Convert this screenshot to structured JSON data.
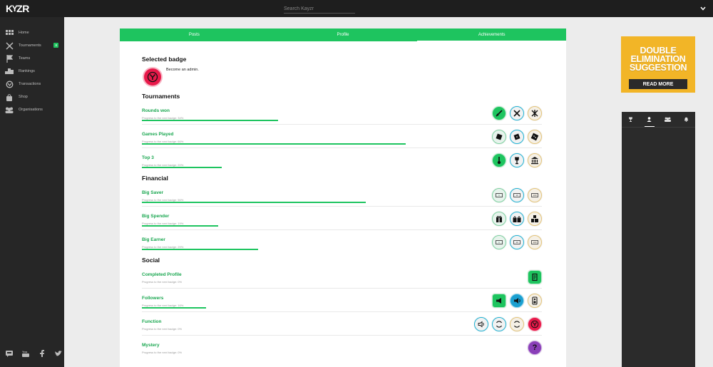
{
  "topbar": {
    "logo_k": "K",
    "logo_v": "Y",
    "logo_zr": "ZR",
    "search_placeholder": "Search Kayzr"
  },
  "sidebar": {
    "items": [
      {
        "label": "Home",
        "icon": "home-grid-icon"
      },
      {
        "label": "Tournaments",
        "icon": "crossed-swords-icon",
        "badge": "8"
      },
      {
        "label": "Teams",
        "icon": "banner-icon"
      },
      {
        "label": "Rankings",
        "icon": "podium-icon"
      },
      {
        "label": "Transactions",
        "icon": "cycle-icon"
      },
      {
        "label": "Shop",
        "icon": "bag-icon"
      },
      {
        "label": "Organisations",
        "icon": "group-icon"
      }
    ],
    "social": [
      "chat-icon",
      "youtube-icon",
      "facebook-icon",
      "twitter-icon"
    ]
  },
  "tabs": [
    {
      "label": "Posts",
      "active": false
    },
    {
      "label": "Profile",
      "active": false
    },
    {
      "label": "Achievements",
      "active": true
    }
  ],
  "selected": {
    "title": "Selected badge",
    "text": "Become an admin."
  },
  "sections": {
    "tournaments": "Tournaments",
    "financial": "Financial",
    "social": "Social"
  },
  "rows": [
    {
      "name": "Rounds won",
      "progress": "Progress to the next badge: 34%",
      "pct": 34
    },
    {
      "name": "Games Played",
      "progress": "Progress to the next badge: 66%",
      "pct": 66
    },
    {
      "name": "Top 3",
      "progress": "Progress to the next badge: 20%",
      "pct": 20
    },
    {
      "name": "Big Saver",
      "progress": "Progress to the next badge: 56%",
      "pct": 56
    },
    {
      "name": "Big Spender",
      "progress": "Progress to the next badge: 19%",
      "pct": 19
    },
    {
      "name": "Big Earner",
      "progress": "Progress to the next badge: 29%",
      "pct": 29
    },
    {
      "name": "Completed Profile",
      "progress": "Progress to the next badge: 0%",
      "pct": 0
    },
    {
      "name": "Followers",
      "progress": "Progress to the next badge: 16%",
      "pct": 16
    },
    {
      "name": "Function",
      "progress": "Progress to the next badge: 0%",
      "pct": 0
    },
    {
      "name": "Mystery",
      "progress": "Progress to the next badge: 0%",
      "pct": 0
    }
  ],
  "bills": {
    "one": "1",
    "ten": "10",
    "hundred": "100"
  },
  "mystery_mark": "?",
  "ad": {
    "line1": "DOUBLE",
    "line2": "ELIMINATION",
    "line3": "SUGGESTION",
    "button": "READ MORE"
  },
  "colors": {
    "accent": "#1ec45f",
    "brand_dark": "#1e1e1e",
    "badge_red": "#e8194a",
    "ad_yellow": "#f2b527"
  }
}
